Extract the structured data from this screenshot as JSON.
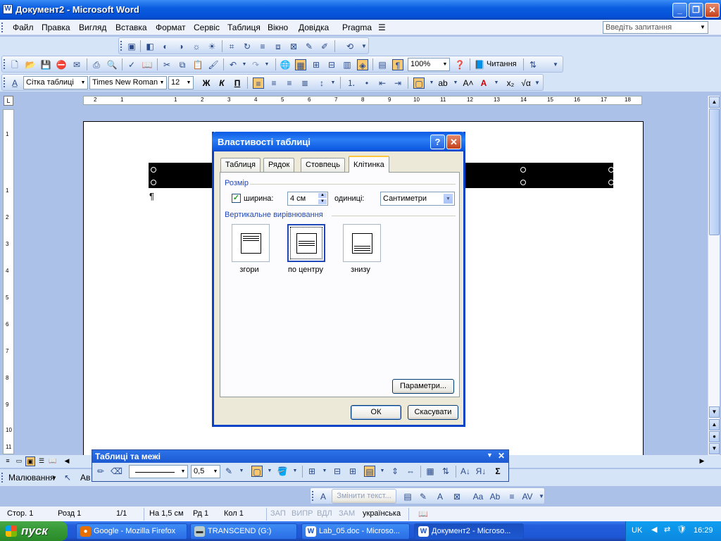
{
  "window": {
    "title": "Документ2 - Microsoft Word",
    "app_icon": "W",
    "controls": [
      "minimize",
      "restore",
      "close"
    ]
  },
  "menu": {
    "items": [
      "Файл",
      "Правка",
      "Вигляд",
      "Вставка",
      "Формат",
      "Сервіс",
      "Таблиця",
      "Вікно",
      "Довідка",
      "Pragma"
    ],
    "help_placeholder": "Введіть запитання"
  },
  "format_toolbar": {
    "style": "Сітка таблиці",
    "font": "Times New Roman",
    "size": "12",
    "bold": "Ж",
    "italic": "К",
    "underline": "П"
  },
  "standard_toolbar": {
    "zoom": "100%",
    "reading": "Читання"
  },
  "ruler": {
    "h_numbers": [
      "2",
      "1",
      "1",
      "2",
      "3",
      "4",
      "5",
      "6",
      "7",
      "8",
      "9",
      "10",
      "11",
      "12",
      "13",
      "14",
      "15",
      "16",
      "17",
      "18"
    ],
    "v_numbers": [
      "1",
      "1",
      "2",
      "3",
      "4",
      "5",
      "6",
      "7",
      "8",
      "9",
      "10",
      "11"
    ]
  },
  "document": {
    "paragraph_mark": "¶"
  },
  "dialog": {
    "title": "Властивості таблиці",
    "help_btn": "?",
    "close_btn": "✕",
    "tabs": [
      "Таблиця",
      "Рядок",
      "Стовпець",
      "Клітинка"
    ],
    "selected_tab": "Клітинка",
    "size_group": "Розмір",
    "width_checkbox": "ширина:",
    "width_checked": true,
    "width_value": "4 см",
    "units_label": "одиниці:",
    "units_value": "Сантиметри",
    "valign_group": "Вертикальне вирівнювання",
    "align_options": [
      "згори",
      "по центру",
      "знизу"
    ],
    "selected_align": "по центру",
    "params_button": "Параметри...",
    "ok_button": "ОК",
    "cancel_button": "Скасувати"
  },
  "tables_toolbar": {
    "title": "Таблиці та межі",
    "line_weight": "0,5"
  },
  "drawing_toolbar": {
    "label": "Малювання",
    "autoshapes": "Ав",
    "wordart_text": "Змінити текст..."
  },
  "status": {
    "page": "Стор.  1",
    "section": "Розд  1",
    "pages": "1/1",
    "position": "На  1,5 см",
    "line": "Рд  1",
    "col": "Кол  1",
    "rec": "ЗАП",
    "trk": "ВИПР",
    "ext": "ВДЛ",
    "ovr": "ЗАМ",
    "language": "українська"
  },
  "taskbar": {
    "start": "пуск",
    "buttons": [
      {
        "label": "Google - Mozilla Firefox",
        "icon": "firefox-icon"
      },
      {
        "label": "TRANSCEND (G:)",
        "icon": "drive-icon"
      },
      {
        "label": "Lab_05.doc - Microso...",
        "icon": "word-icon"
      },
      {
        "label": "Документ2 - Microso...",
        "icon": "word-icon"
      }
    ],
    "lang": "UK",
    "clock": "16:29"
  }
}
